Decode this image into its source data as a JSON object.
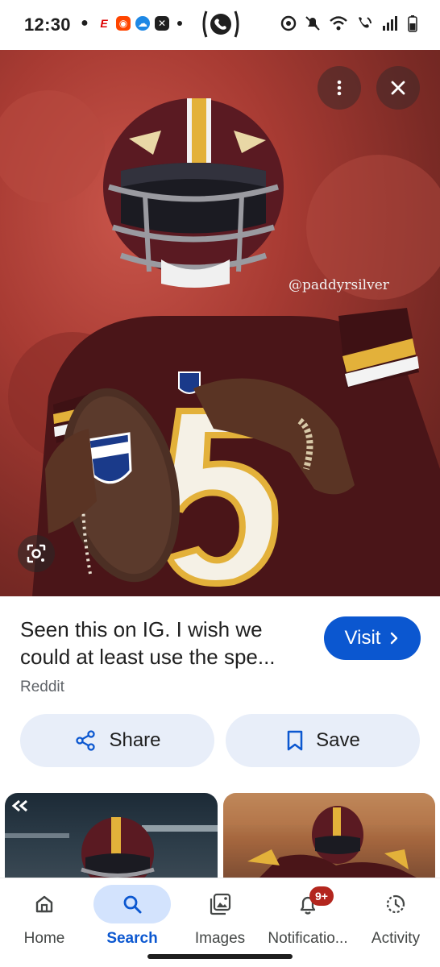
{
  "status_bar": {
    "time": "12:30"
  },
  "hero": {
    "watermark": "@paddyrsilver",
    "jersey_number": "5",
    "ball_logo": "NFL"
  },
  "result": {
    "title": "Seen this on IG. I wish we could at least use the spe...",
    "source": "Reddit",
    "visit_label": "Visit"
  },
  "actions": {
    "share_label": "Share",
    "save_label": "Save"
  },
  "nav": {
    "items": [
      {
        "label": "Home",
        "icon": "home-icon"
      },
      {
        "label": "Search",
        "icon": "search-icon",
        "active": true
      },
      {
        "label": "Images",
        "icon": "images-icon"
      },
      {
        "label": "Notificatio...",
        "icon": "bell-icon",
        "badge": "9+"
      },
      {
        "label": "Activity",
        "icon": "activity-icon"
      }
    ]
  },
  "colors": {
    "accent": "#0b57d0",
    "chip_bg": "#e8eef9",
    "badge": "#b3261e"
  }
}
